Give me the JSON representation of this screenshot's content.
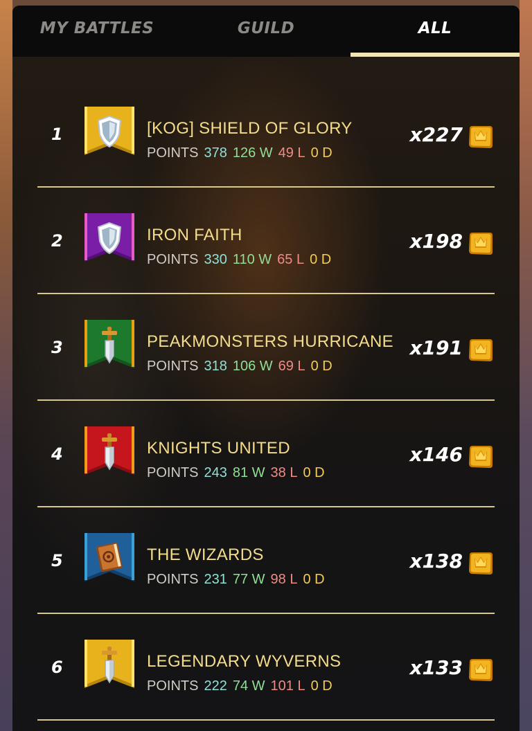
{
  "tabs": [
    {
      "label": "MY BATTLES",
      "active": false
    },
    {
      "label": "GUILD",
      "active": false
    },
    {
      "label": "ALL",
      "active": true
    }
  ],
  "colors": {
    "accent": "#f2e6b0",
    "name": "#f3dc8b",
    "points": "#8fe0d6",
    "wins": "#8fdf96",
    "losses": "#f08b86",
    "draws": "#f2cc55"
  },
  "guilds": [
    {
      "rank": "1",
      "name": "[KOG] SHIELD OF GLORY",
      "points_label": "POINTS",
      "points": "378",
      "wins": "126 W",
      "losses": "49 L",
      "draws": "0 D",
      "count": "x227",
      "banner_color": "gold",
      "emblem": "shield-icon"
    },
    {
      "rank": "2",
      "name": "IRON FAITH",
      "points_label": "POINTS",
      "points": "330",
      "wins": "110 W",
      "losses": "65 L",
      "draws": "0 D",
      "count": "x198",
      "banner_color": "purple",
      "emblem": "shield-icon"
    },
    {
      "rank": "3",
      "name": "PEAKMONSTERS HURRICANE",
      "points_label": "POINTS",
      "points": "318",
      "wins": "106 W",
      "losses": "69 L",
      "draws": "0 D",
      "count": "x191",
      "banner_color": "green",
      "emblem": "sword-icon"
    },
    {
      "rank": "4",
      "name": "KNIGHTS UNITED",
      "points_label": "POINTS",
      "points": "243",
      "wins": "81 W",
      "losses": "38 L",
      "draws": "0 D",
      "count": "x146",
      "banner_color": "red",
      "emblem": "sword-icon"
    },
    {
      "rank": "5",
      "name": "THE WIZARDS",
      "points_label": "POINTS",
      "points": "231",
      "wins": "77 W",
      "losses": "98 L",
      "draws": "0 D",
      "count": "x138",
      "banner_color": "blue",
      "emblem": "book-icon"
    },
    {
      "rank": "6",
      "name": "LEGENDARY WYVERNS",
      "points_label": "POINTS",
      "points": "222",
      "wins": "74 W",
      "losses": "101 L",
      "draws": "0 D",
      "count": "x133",
      "banner_color": "gold",
      "emblem": "sword-icon"
    }
  ]
}
